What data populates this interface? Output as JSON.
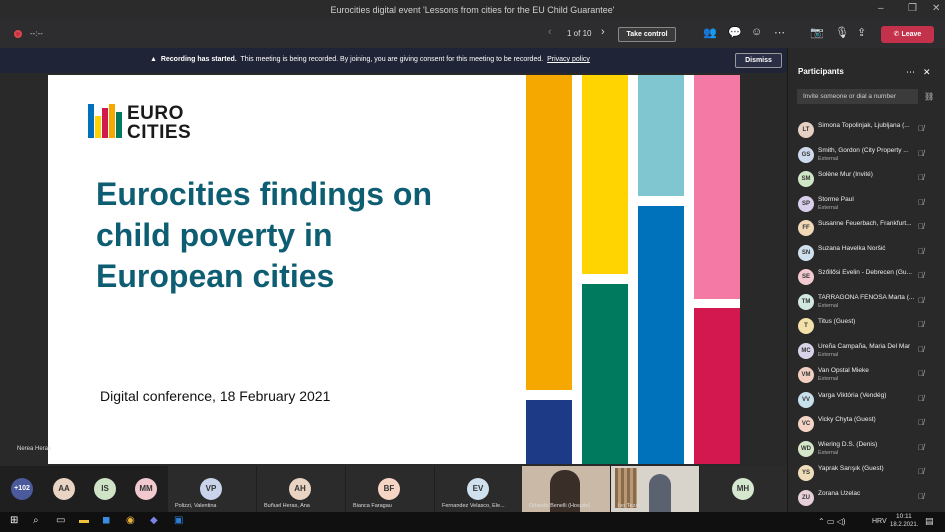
{
  "window": {
    "title": "Eurocities digital event 'Lessons from cities for the EU Child Guarantee'"
  },
  "toolbar": {
    "timer": "--:--",
    "page": "1 of 10",
    "take_control": "Take control",
    "leave": "Leave"
  },
  "banner": {
    "bold": "Recording has started.",
    "text": "This meeting is being recorded. By joining, you are giving consent for this meeting to be recorded.",
    "link": "Privacy policy",
    "dismiss": "Dismiss"
  },
  "slide": {
    "logo": "EURO\nCITIES",
    "title": "Eurocities findings on child poverty in European cities",
    "subtitle": "Digital conference, 18 February 2021",
    "colors": [
      "#f5a800",
      "#ffd400",
      "#7fc6d1",
      "#f47aa5",
      "#007a5e",
      "#0072bc",
      "#d3184f",
      "#1c3a85"
    ]
  },
  "presenter_label": "Nerea Heras",
  "strip": [
    {
      "initials": "+102",
      "name": ""
    },
    {
      "initials": "AA",
      "name": ""
    },
    {
      "initials": "IS",
      "name": ""
    },
    {
      "initials": "MM",
      "name": ""
    },
    {
      "initials": "VP",
      "name": "Polizzi, Valentina"
    },
    {
      "initials": "AH",
      "name": "Buñuel Heras, Ana"
    },
    {
      "initials": "BF",
      "name": "Bianca Faragau"
    },
    {
      "initials": "EV",
      "name": "Fernandez Velasco, Ele..."
    },
    {
      "initials": "",
      "name": "Orlando Benelli (Hospite)"
    },
    {
      "initials": "",
      "name": "Ivo Tezak"
    },
    {
      "initials": "MH",
      "name": ""
    }
  ],
  "participants": {
    "title": "Participants",
    "invite_placeholder": "Invite someone or dial a number",
    "list": [
      {
        "initials": "LT",
        "name": "Simona Topolinjak, Ljubljana (...",
        "sub": ""
      },
      {
        "initials": "GS",
        "name": "Smith, Gordon (City Property ...",
        "sub": "External"
      },
      {
        "initials": "SM",
        "name": "Solène Mur (Invité)",
        "sub": ""
      },
      {
        "initials": "SP",
        "name": "Storme Paul",
        "sub": "External"
      },
      {
        "initials": "FF",
        "name": "Susanne Feuerbach, Frankfurt...",
        "sub": ""
      },
      {
        "initials": "SN",
        "name": "Suzana Havelka Noršić",
        "sub": ""
      },
      {
        "initials": "SE",
        "name": "Szőllősi Evelin - Debrecen (Gu...",
        "sub": ""
      },
      {
        "initials": "TM",
        "name": "TARRAGONA FENOSA Marta (...",
        "sub": "External"
      },
      {
        "initials": "T",
        "name": "Titus (Guest)",
        "sub": ""
      },
      {
        "initials": "MC",
        "name": "Ureña Campaña, Maria Del Mar",
        "sub": "External"
      },
      {
        "initials": "VM",
        "name": "Van Opstal Mieke",
        "sub": "External"
      },
      {
        "initials": "VV",
        "name": "Varga Viktória (Vendég)",
        "sub": ""
      },
      {
        "initials": "VC",
        "name": "Vicky Chyta (Guest)",
        "sub": ""
      },
      {
        "initials": "WD",
        "name": "Wiering D.S. (Denis)",
        "sub": "External"
      },
      {
        "initials": "YS",
        "name": "Yaprak Sarışık (Guest)",
        "sub": ""
      },
      {
        "initials": "ZU",
        "name": "Zorana Uzelac",
        "sub": ""
      }
    ]
  },
  "taskbar": {
    "lang": "HRV",
    "time": "10:11",
    "date": "18.2.2021.",
    "badge": "2"
  }
}
